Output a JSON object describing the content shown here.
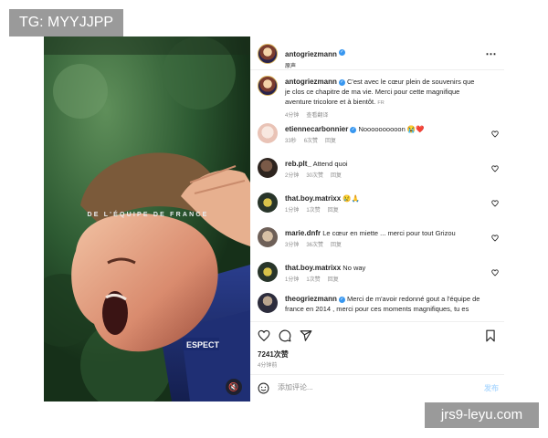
{
  "watermarks": {
    "top": "TG: MYYJJPP",
    "bottom": "jrs9-leyu.com"
  },
  "media": {
    "caption": "DE L'ÉQUIPE DE FRANCE",
    "jersey_text": "ESPECT",
    "mute_icon": "speaker-muted-icon"
  },
  "header": {
    "username": "antogriezmann",
    "subtitle": "原声",
    "more_icon": "more-horizontal-icon"
  },
  "comments": [
    {
      "username": "antogriezmann",
      "verified": true,
      "text": "C'est avec le cœur plein de souvenirs que je clos ce chapitre de ma vie. Merci pour cette magnifique aventure tricolore et à bientôt.",
      "lang": "FR",
      "meta": [
        "4分钟",
        "查看翻译"
      ],
      "avatar": "av-ag",
      "heart": false
    },
    {
      "username": "etiennecarbonnier",
      "verified": true,
      "text": "Noooooooooon 😭❤️",
      "meta": [
        "33秒",
        "6次赞",
        "回复"
      ],
      "avatar": "av-et",
      "heart": true
    },
    {
      "username": "reb.plt_",
      "verified": false,
      "text": "Attend quoi",
      "meta": [
        "2分钟",
        "30次赞",
        "回复"
      ],
      "avatar": "av-reb",
      "heart": true
    },
    {
      "username": "that.boy.matrixx",
      "verified": false,
      "text": "😢🙏",
      "meta": [
        "1分钟",
        "1次赞",
        "回复"
      ],
      "avatar": "av-tbm",
      "heart": true
    },
    {
      "username": "marie.dnfr",
      "verified": false,
      "text": "Le cœur en miette ... merci pour tout Grizou",
      "meta": [
        "3分钟",
        "36次赞",
        "回复"
      ],
      "avatar": "av-mar",
      "heart": true
    },
    {
      "username": "that.boy.matrixx",
      "verified": false,
      "text": "No way",
      "meta": [
        "1分钟",
        "1次赞",
        "回复"
      ],
      "avatar": "av-tbm",
      "heart": true
    },
    {
      "username": "theogriezmann",
      "verified": true,
      "text": "Merci de m'avoir redonné gout a l'équipe de france en 2014 , merci pour ces moments magnifiques, tu es",
      "meta": [],
      "avatar": "av-thg",
      "heart": false
    }
  ],
  "actions": {
    "likes": "7241次赞",
    "time_ago": "4分钟前"
  },
  "add_comment": {
    "placeholder": "添加评论...",
    "post_label": "发布"
  }
}
